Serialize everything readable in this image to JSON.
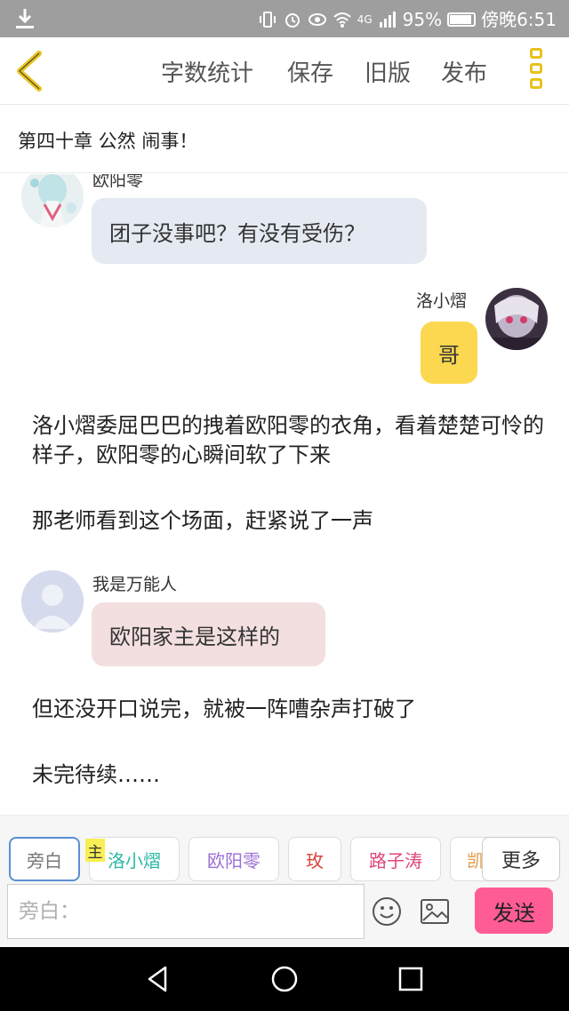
{
  "status_bar": {
    "network": "4G",
    "battery": "95%",
    "time": "傍晚6:51"
  },
  "toolbar": {
    "word_count": "字数统计",
    "save": "保存",
    "old_version": "旧版",
    "publish": "发布"
  },
  "chapter": {
    "title": "第四十章 公然 闹事！"
  },
  "messages": [
    {
      "speaker": "欧阳零",
      "text": "团子没事吧？有没有受伤？",
      "side": "left",
      "bubble_color": "#e4e9f2"
    },
    {
      "speaker": "洛小熠",
      "text": "哥",
      "side": "right",
      "bubble_color": "#fbd84f"
    },
    {
      "narration": "洛小熠委屈巴巴的拽着欧阳零的衣角，看着楚楚可怜的样子，欧阳零的心瞬间软了下来"
    },
    {
      "narration": "那老师看到这个场面，赶紧说了一声"
    },
    {
      "speaker": "我是万能人",
      "text": "欧阳家主是这样的",
      "side": "left",
      "bubble_color": "#f3dfe0"
    },
    {
      "narration": "但还没开口说完，就被一阵嘈杂声打破了"
    },
    {
      "narration": "未完待续……"
    }
  ],
  "role_bar": {
    "main_badge": "主",
    "roles": [
      {
        "label": "旁白",
        "color": "#777777"
      },
      {
        "label": "洛小熠",
        "color": "#2bb7a5"
      },
      {
        "label": "欧阳零",
        "color": "#9b6fd6"
      },
      {
        "label": "玫",
        "color": "#d8443c"
      },
      {
        "label": "路子涛",
        "color": "#e0457a"
      },
      {
        "label": "凯",
        "color": "#e59a4a"
      }
    ],
    "more": "更多"
  },
  "input": {
    "placeholder": "旁白：",
    "send": "发送"
  },
  "colors": {
    "accent_yellow": "#e8c21e",
    "send_pink": "#ff5c95"
  }
}
